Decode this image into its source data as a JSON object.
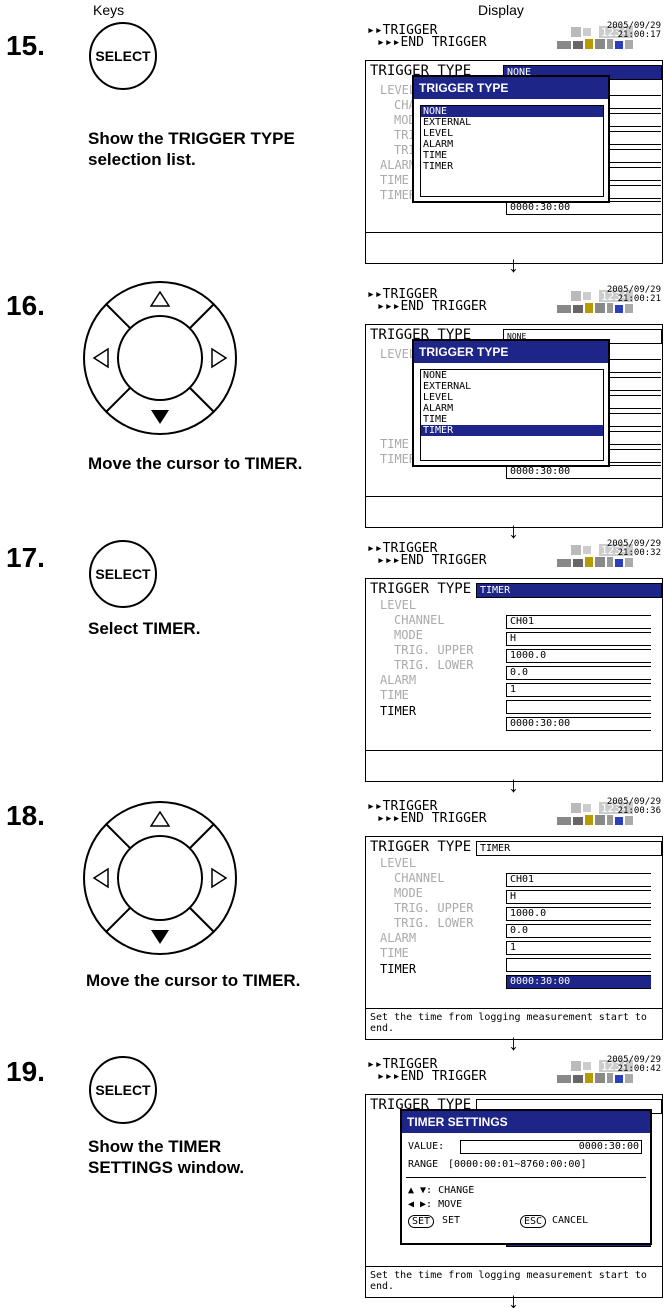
{
  "headers": {
    "keys": "Keys",
    "display": "Display"
  },
  "steps": [
    {
      "num": "15.",
      "key": "SELECT",
      "caption": "Show the TRIGGER TYPE selection list."
    },
    {
      "num": "16.",
      "key": "arrow-down",
      "caption": "Move the cursor to TIMER."
    },
    {
      "num": "17.",
      "key": "SELECT",
      "caption": "Select TIMER."
    },
    {
      "num": "18.",
      "key": "arrow-down",
      "caption": "Move the cursor to TIMER."
    },
    {
      "num": "19.",
      "key": "SELECT",
      "caption": "Show the TIMER SETTINGS window."
    }
  ],
  "screen": {
    "line1": "▸▸TRIGGER",
    "line2": "▸▸▸END TRIGGER",
    "indicator": "1234",
    "date": "2005/09/29",
    "times": [
      "21:00:17",
      "21:00:21",
      "21:00:32",
      "21:00:36",
      "21:00:42"
    ],
    "labels": {
      "trigger_type": "TRIGGER TYPE",
      "level": "LEVEL",
      "channel": "CHANNEL",
      "mode": "MODE",
      "upper": "TRIG. UPPER",
      "lower": "TRIG. LOWER",
      "alarm": "ALARM",
      "time": "TIME",
      "timer": "TIMER"
    },
    "values": {
      "none": "NONE",
      "timer_type": "TIMER",
      "channel": "CH01",
      "mode": "H",
      "upper": "1000.0",
      "lower": "0.0",
      "alarm": "1",
      "time": "",
      "timer": "0000:30:00"
    },
    "message": "Set the time from logging measurement start to end."
  },
  "popup": {
    "title": "TRIGGER TYPE",
    "options": [
      "NONE",
      "EXTERNAL",
      "LEVEL",
      "ALARM",
      "TIME",
      "TIMER"
    ]
  },
  "timer_popup": {
    "title": "TIMER SETTINGS",
    "value_label": "VALUE:",
    "value": "0000:30:00",
    "range_label": "RANGE",
    "range": "[0000:00:01~8760:00:00]",
    "change": "▲ ▼: CHANGE",
    "move": "◀ ▶: MOVE",
    "set_key": "SET",
    "set": "SET",
    "esc_key": "ESC",
    "cancel": "CANCEL"
  },
  "arrow_glyph": "↓"
}
